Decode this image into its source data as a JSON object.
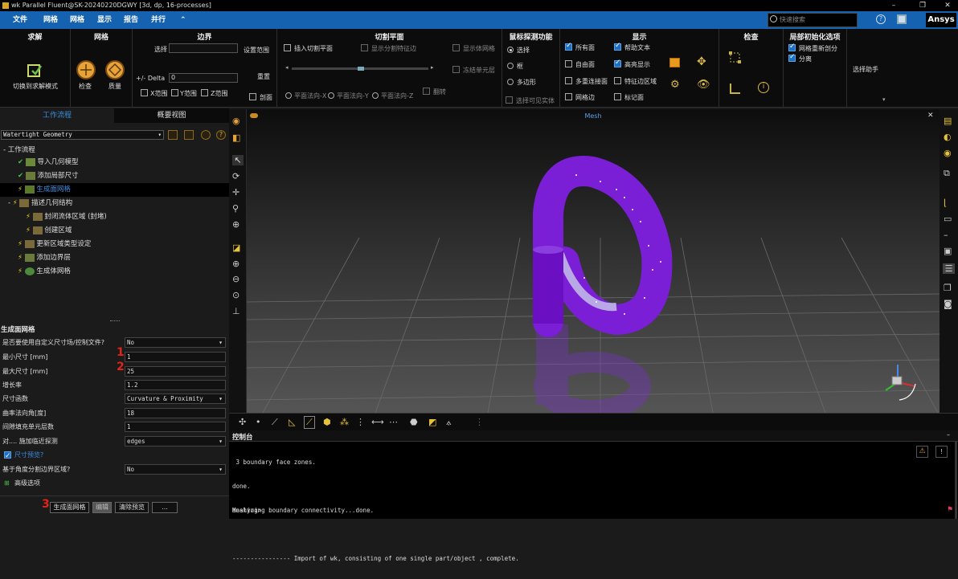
{
  "window": {
    "title": "wk Parallel Fluent@SK-20240220DGWY  [3d, dp, 16-processes]",
    "min": "–",
    "max": "❐",
    "close": "✕"
  },
  "menu": {
    "items": [
      "文件",
      "网格",
      "显示",
      "报告",
      "并行",
      "⌃"
    ],
    "search_placeholder": "快速搜索",
    "brand": "Ansys"
  },
  "ribbon": {
    "solve": {
      "title": "求解",
      "switch_label": "切换到求解模式"
    },
    "mesh": {
      "title": "网格",
      "check_label": "检查",
      "quality_label": "质量"
    },
    "bounds": {
      "title": "边界",
      "select_label": "选择",
      "set_range_label": "设置范围",
      "delta_label": "+/- Delta",
      "delta_value": "0",
      "reset_label": "重置",
      "x_label": "X范围",
      "y_label": "Y范围",
      "z_label": "Z范围",
      "clip_label": "剖面"
    },
    "cut": {
      "title": "切割平面",
      "insert_label": "插入切割平面",
      "show_edges_label": "显示分割特征边",
      "show_mesh_label": "显示体网格",
      "freeze_label": "冻结单元层",
      "flip_label": "翻转",
      "px_label": "平面法向-X",
      "py_label": "平面法向-Y",
      "pz_label": "平面法向-Z"
    },
    "probe": {
      "title": "鼠标探测功能",
      "select_label": "选择",
      "box_label": "框",
      "poly_label": "多边形",
      "visible_label": "选择可见实体"
    },
    "display": {
      "title": "显示",
      "all_faces_label": "所有面",
      "help_text_label": "帮助文本",
      "free_faces_label": "自由面",
      "highlight_label": "高亮显示",
      "multi_label": "多重连接面",
      "feature_label": "特征边区域",
      "mesh_edges_label": "网格边",
      "mark_label": "标记面"
    },
    "inspect": {
      "title": "检查"
    },
    "local": {
      "title": "局部初始化选项",
      "remesh_label": "网格重新剖分",
      "split_label": "分离"
    },
    "helper": {
      "label": "选择助手"
    }
  },
  "left": {
    "tabs": [
      "工作流程",
      "概要视图"
    ],
    "workflow_select": "Watertight Geometry",
    "tree_root": "工作流程",
    "tree": [
      {
        "label": "导入几何模型",
        "status": "✔"
      },
      {
        "label": "添加局部尺寸",
        "status": "✔"
      },
      {
        "label": "生成面网格",
        "status": "⚡"
      },
      {
        "label": "描述几何结构",
        "status": "⚡"
      },
      {
        "label": "封闭流体区域 (封堵)",
        "status": "⚡"
      },
      {
        "label": "创建区域",
        "status": "⚡"
      },
      {
        "label": "更新区域类型设定",
        "status": "⚡"
      },
      {
        "label": "添加边界层",
        "status": "⚡"
      },
      {
        "label": "生成体网格",
        "status": "⚡"
      }
    ],
    "props_title": "生成面网格",
    "props": [
      {
        "label": "是否要使用自定义尺寸场/控制文件?",
        "value": "No"
      },
      {
        "label": "最小尺寸 [mm]",
        "value": "1"
      },
      {
        "label": "最大尺寸 [mm]",
        "value": "25"
      },
      {
        "label": "增长率",
        "value": "1.2"
      },
      {
        "label": "尺寸函数",
        "value": "Curvature & Proximity"
      },
      {
        "label": "曲率法向角[度]",
        "value": "18"
      },
      {
        "label": "间隙填充单元层数",
        "value": "1"
      },
      {
        "label": "对.... 施加临近探测",
        "value": "edges"
      }
    ],
    "preview_label": "尺寸预览?",
    "angle_label": "基于角度分割边界区域?",
    "angle_value": "No",
    "advanced_label": "高级选项",
    "btn_generate": "生成面网格",
    "btn_edit": "编辑",
    "btn_clear": "清除预览",
    "btn_more": "...",
    "marks": [
      "1",
      "2",
      "3"
    ]
  },
  "graphics": {
    "title": "Mesh",
    "close": "✕"
  },
  "console": {
    "title": "控制台",
    "lines": [
      " 3 boundary face zones.",
      "done.",
      "analyzing boundary connectivity...done.",
      "",
      "---------------- Import of wk, consisting of one single part/object , complete."
    ],
    "prompt": "Meshing>"
  }
}
